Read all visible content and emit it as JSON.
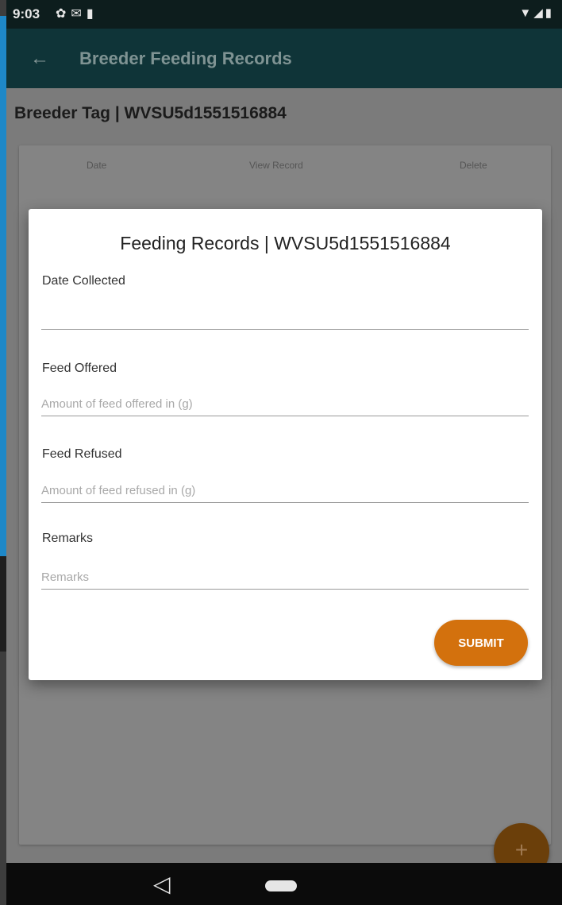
{
  "status_bar": {
    "time": "9:03",
    "left_icons": [
      "gear-icon",
      "gmail-icon",
      "sd-card-icon"
    ],
    "right_icons": [
      "wifi-icon",
      "signal-icon",
      "battery-icon"
    ]
  },
  "app_bar": {
    "back_icon": "arrow-left-icon",
    "title": "Breeder Feeding Records"
  },
  "page": {
    "breeder_tag": "Breeder Tag | WVSU5d1551516884",
    "table_headers": [
      "Date",
      "View Record",
      "Delete"
    ]
  },
  "dialog": {
    "title": "Feeding Records | WVSU5d1551516884",
    "fields": [
      {
        "label": "Date Collected",
        "placeholder": ""
      },
      {
        "label": "Feed Offered",
        "placeholder": "Amount of feed offered in (g)"
      },
      {
        "label": "Feed Refused",
        "placeholder": "Amount of feed refused in (g)"
      },
      {
        "label": "Remarks",
        "placeholder": "Remarks"
      }
    ],
    "submit_label": "SUBMIT"
  },
  "fab": {
    "label": "+"
  },
  "colors": {
    "app_bar": "#0f3438",
    "accent": "#d3710d",
    "scrim": "#7b7b7b"
  }
}
